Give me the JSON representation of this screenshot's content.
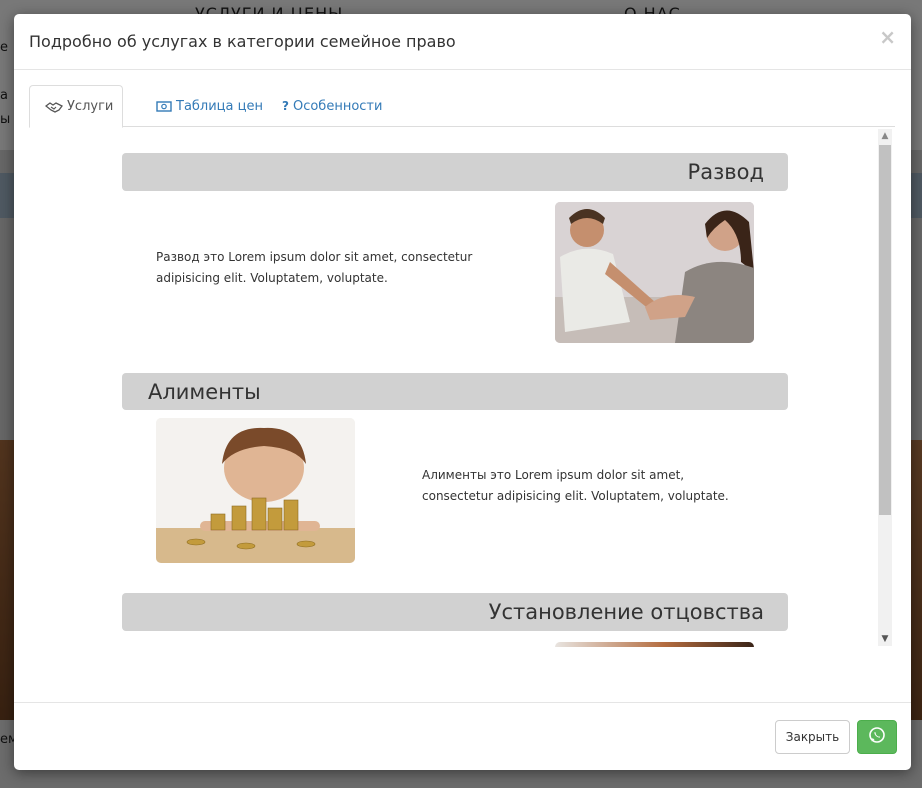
{
  "background": {
    "nav_items": [
      "УСЛУГИ И ЦЕНЫ",
      "О НАС"
    ],
    "side_text": [
      "е",
      "а",
      "ы"
    ],
    "bottom_text": "ем"
  },
  "modal": {
    "title": "Подробно об услугах в категории семейное право",
    "close_symbol": "×"
  },
  "tabs": [
    {
      "label": "Услуги",
      "icon": "handshake-icon",
      "active": true
    },
    {
      "label": "Таблица цен",
      "icon": "money-icon",
      "active": false
    },
    {
      "label": "Особенности",
      "icon": "question-icon",
      "active": false
    }
  ],
  "sections": [
    {
      "title": "Развод",
      "text": "Развод это Lorem ipsum dolor sit amet, consectetur adipisicing elit. Voluptatem, voluptate.",
      "image": "couple-photo"
    },
    {
      "title": "Алименты",
      "text": "Алименты это Lorem ipsum dolor sit amet, consectetur adipisicing elit. Voluptatem, voluptate.",
      "image": "child-coins-photo"
    },
    {
      "title": "Установление отцовства",
      "text": "",
      "image": "family-photo"
    }
  ],
  "footer": {
    "close_label": "Закрыть",
    "whatsapp_icon": "whatsapp-icon"
  },
  "colors": {
    "accent": "#337ab7",
    "success": "#5cb85c",
    "section_bar": "#d1d1d1"
  }
}
